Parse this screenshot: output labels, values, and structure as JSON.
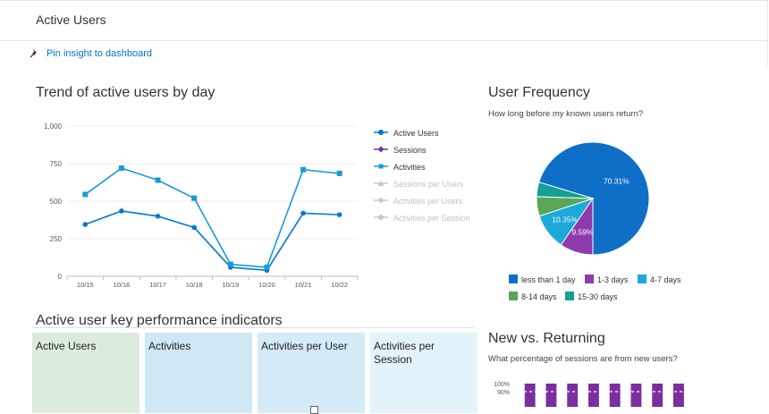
{
  "header": {
    "title": "Active Users"
  },
  "toolbar": {
    "pin_label": "Pin insight to dashboard"
  },
  "trend": {
    "title": "Trend of active users by day",
    "legend": [
      {
        "label": "Active Users",
        "color": "#0078d4",
        "marker": "circle",
        "active": true
      },
      {
        "label": "Sessions",
        "color": "#7a2ea0",
        "marker": "diamond",
        "active": true
      },
      {
        "label": "Activities",
        "color": "#1a9ad6",
        "marker": "square",
        "active": true
      },
      {
        "label": "Sessions per Users",
        "color": "#c8c8c8",
        "marker": "triangle",
        "active": false
      },
      {
        "label": "Activities per Users",
        "color": "#c8c8c8",
        "marker": "diamond",
        "active": false
      },
      {
        "label": "Activities per Session",
        "color": "#c8c8c8",
        "marker": "circle",
        "active": false
      }
    ]
  },
  "frequency": {
    "title": "User Frequency",
    "subtitle": "How long before my known users return?",
    "legend": [
      {
        "label": "less than 1 day",
        "color": "#0f6fc6"
      },
      {
        "label": "1-3 days",
        "color": "#8e3bab"
      },
      {
        "label": "4-7 days",
        "color": "#1aa9d9"
      },
      {
        "label": "8-14 days",
        "color": "#5aa658"
      },
      {
        "label": "15-30 days",
        "color": "#16a096"
      }
    ]
  },
  "kpi": {
    "title": "Active user key performance indicators",
    "tiles": [
      {
        "label": "Active Users",
        "color": "#dcecdc"
      },
      {
        "label": "Activities",
        "color": "#cfe8f5"
      },
      {
        "label": "Activities per User",
        "color": "#d5ebf7"
      },
      {
        "label": "Activities per Session",
        "color": "#e3f3fa"
      }
    ]
  },
  "newret": {
    "title": "New vs. Returning",
    "subtitle": "What percentage of sessions are from new users?"
  },
  "chart_data": [
    {
      "type": "line",
      "title": "Trend of active users by day",
      "categories": [
        "10/15",
        "10/16",
        "10/17",
        "10/18",
        "10/19",
        "10/20",
        "10/21",
        "10/22"
      ],
      "yticks": [
        "0",
        "250",
        "500",
        "750",
        "1,000"
      ],
      "ylim": [
        0,
        1000
      ],
      "series": [
        {
          "name": "Active Users",
          "color": "#0078d4",
          "values": [
            345,
            435,
            400,
            325,
            60,
            40,
            420,
            410
          ]
        },
        {
          "name": "Activities",
          "color": "#1a9ad6",
          "values": [
            545,
            720,
            640,
            520,
            80,
            60,
            710,
            685
          ]
        }
      ],
      "grid": true,
      "legend": "right"
    },
    {
      "type": "pie",
      "title": "User Frequency",
      "slices": [
        {
          "label": "less than 1 day",
          "value": 70.31,
          "display": "70.31%",
          "color": "#0f6fc6"
        },
        {
          "label": "1-3 days",
          "value": 9.59,
          "display": "9.59%",
          "color": "#8e3bab"
        },
        {
          "label": "4-7 days",
          "value": 10.35,
          "display": "10.35%",
          "color": "#1aa9d9"
        },
        {
          "label": "8-14 days",
          "value": 5.6,
          "display": "",
          "color": "#5aa658"
        },
        {
          "label": "15-30 days",
          "value": 4.15,
          "display": "",
          "color": "#16a096"
        }
      ],
      "legend": "bottom"
    },
    {
      "type": "bar",
      "title": "New vs. Returning",
      "yticks": [
        "100%",
        "90%"
      ],
      "values": [
        100,
        100,
        100,
        100,
        100,
        100,
        100,
        100
      ],
      "color": "#7a2ea0"
    }
  ]
}
